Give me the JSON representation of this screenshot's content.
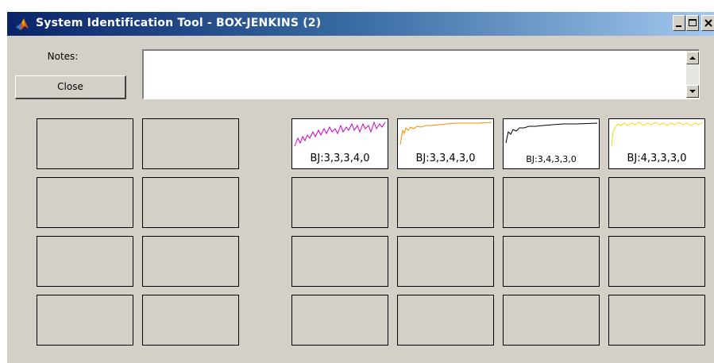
{
  "window": {
    "title": "System Identification Tool - BOX-JENKINS (2)",
    "caption_buttons": [
      "minimize-icon",
      "maximize-icon",
      "close-icon"
    ]
  },
  "notes": {
    "label": "Notes:",
    "value": ""
  },
  "close_button": {
    "label": "Close"
  },
  "models": [
    {
      "label": "BJ:3,3,3,4,0",
      "color": "#cc00cc"
    },
    {
      "label": "BJ:3,3,4,3,0",
      "color": "#ff8c00"
    },
    {
      "label": "BJ:3,4,3,3,0",
      "color": "#000000"
    },
    {
      "label": "BJ:4,3,3,3,0",
      "color": "#ffd700"
    }
  ]
}
